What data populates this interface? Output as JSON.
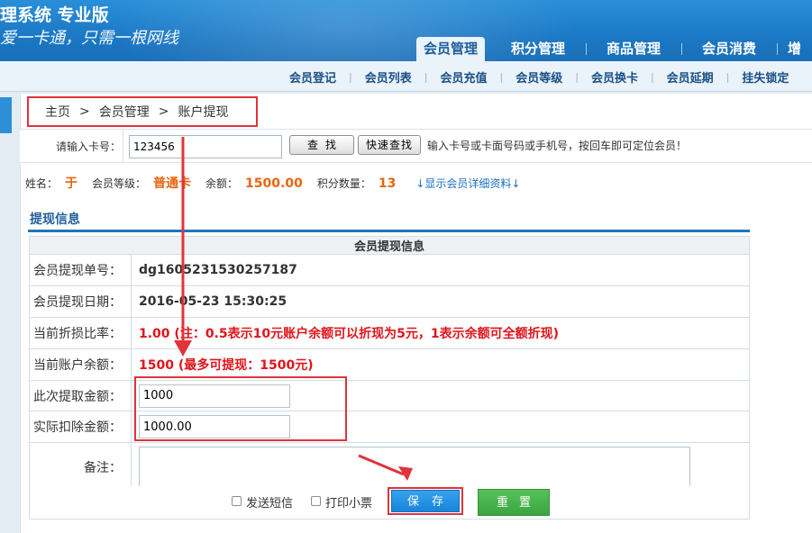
{
  "header": {
    "system_title": "理系统 专业版",
    "slogan": "爱一卡通，只需一根网线"
  },
  "main_nav": [
    {
      "label": "会员管理",
      "active": true
    },
    {
      "label": "积分管理"
    },
    {
      "label": "商品管理"
    },
    {
      "label": "会员消费"
    },
    {
      "label": "增"
    }
  ],
  "sub_nav": [
    "会员登记",
    "会员列表",
    "会员充值",
    "会员等级",
    "会员换卡",
    "会员延期",
    "挂失锁定"
  ],
  "breadcrumb": {
    "home": "主页",
    "sep": ">",
    "module": "会员管理",
    "page": "账户提现"
  },
  "search": {
    "label": "请输入卡号：",
    "value": "123456",
    "search_button": "查找",
    "quick_button": "快速查找",
    "hint": "输入卡号或卡面号码或手机号，按回车即可定位会员！"
  },
  "member": {
    "name_label": "姓名：",
    "name": "于",
    "level_label": "会员等级：",
    "level": "普通卡",
    "balance_label": "余额：",
    "balance": "1500.00",
    "points_label": "积分数量：",
    "points": "13",
    "detail_link": "↓显示会员详细资料↓"
  },
  "section_title": "提现信息",
  "form": {
    "caption": "会员提现信息",
    "order_no_label": "会员提现单号：",
    "order_no": "dg1605231530257187",
    "date_label": "会员提现日期：",
    "date": "2016-05-23 15:30:25",
    "ratio_label": "当前折损比率：",
    "ratio": "1.00 (注：0.5表示10元账户余额可以折现为5元，1表示余额可全额折现)",
    "account_balance_label": "当前账户余额：",
    "account_balance": "1500 (最多可提现：1500元)",
    "withdraw_label": "此次提取金额：",
    "withdraw_value": "1000",
    "deduct_label": "实际扣除金额：",
    "deduct_value": "1000.00",
    "remark_label": "备注："
  },
  "actions": {
    "sms_label": "发送短信",
    "print_label": "打印小票",
    "save": "保存",
    "reset": "重置"
  },
  "colors": {
    "header_blue": "#1b78c5",
    "highlight_red": "#e0343a",
    "save_blue": "#1a84d9",
    "reset_green": "#3ba540"
  }
}
